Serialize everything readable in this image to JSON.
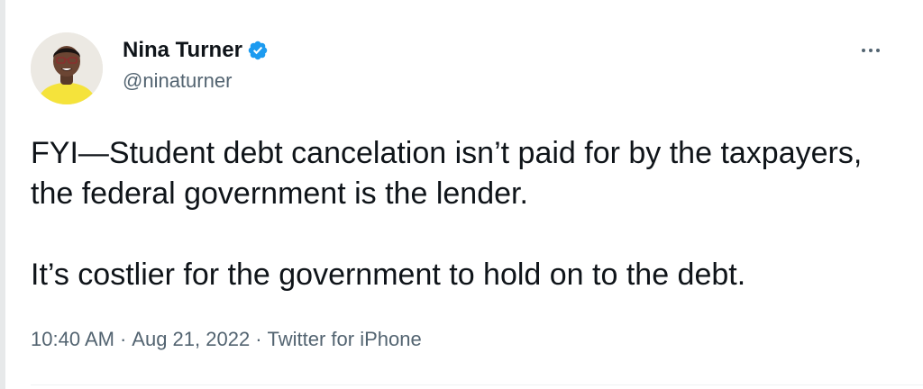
{
  "tweet": {
    "author": {
      "display_name": "Nina Turner",
      "handle": "@ninaturner",
      "verified": true,
      "avatar_icon": "user-avatar-photo",
      "verified_icon": "verified-badge-icon",
      "verified_color": "#1d9bf0"
    },
    "more_icon": "more-options-icon",
    "text_paragraphs": [
      "FYI—Student debt cancelation isn’t paid for by the taxpayers, the federal government is the lender.",
      "It’s costlier for the government to hold on to the debt."
    ],
    "meta": {
      "time": "10:40 AM",
      "separator": "·",
      "date": "Aug 21, 2022",
      "source": "Twitter for iPhone"
    }
  },
  "colors": {
    "text_primary": "#0f1419",
    "text_secondary": "#536471",
    "accent": "#1d9bf0",
    "avatar_shirt": "#f5e33b"
  }
}
